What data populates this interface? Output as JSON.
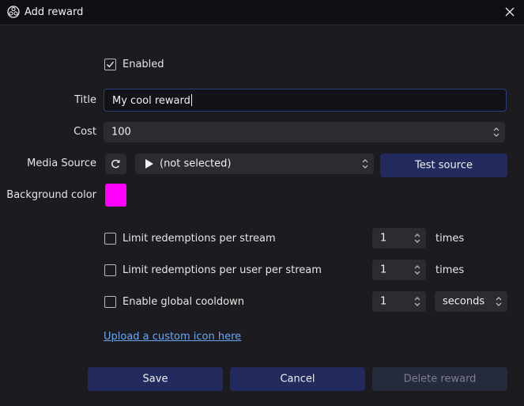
{
  "window": {
    "title": "Add reward"
  },
  "form": {
    "enabled_label": "Enabled",
    "enabled_checked": true,
    "title_label": "Title",
    "title_value": "My cool reward",
    "cost_label": "Cost",
    "cost_value": "100",
    "media_source_label": "Media Source",
    "media_source_value": "(not selected)",
    "test_source_label": "Test source",
    "background_color_label": "Background color",
    "background_color": "#ff00ff"
  },
  "limits": [
    {
      "label": "Limit redemptions per stream",
      "checked": false,
      "value": "1",
      "unit": "times"
    },
    {
      "label": "Limit redemptions per user per stream",
      "checked": false,
      "value": "1",
      "unit": "times"
    },
    {
      "label": "Enable global cooldown",
      "checked": false,
      "value": "1",
      "unit": "seconds"
    }
  ],
  "upload_link": "Upload a custom icon here",
  "buttons": {
    "save": "Save",
    "cancel": "Cancel",
    "delete": "Delete reward"
  },
  "colors": {
    "accent_button": "#232b5e",
    "link": "#6aa8f5",
    "background": "#1c1b20"
  }
}
